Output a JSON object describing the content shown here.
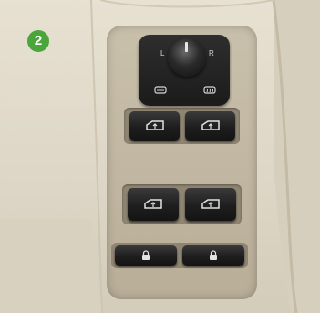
{
  "badge": {
    "number": "2",
    "color": "#4aa63a"
  },
  "mirror_control": {
    "left_label": "L",
    "right_label": "R",
    "icons": [
      "mirror-fold-icon",
      "mirror-heat-icon"
    ]
  },
  "window_switches": [
    {
      "name": "front-left",
      "icon": "window-up-icon"
    },
    {
      "name": "front-right",
      "icon": "window-up-icon"
    },
    {
      "name": "rear-left",
      "icon": "window-up-icon"
    },
    {
      "name": "rear-right",
      "icon": "window-up-icon"
    }
  ],
  "lock_buttons": [
    {
      "name": "child-lock-left",
      "icon": "lock-icon"
    },
    {
      "name": "child-lock-right",
      "icon": "lock-icon"
    }
  ]
}
